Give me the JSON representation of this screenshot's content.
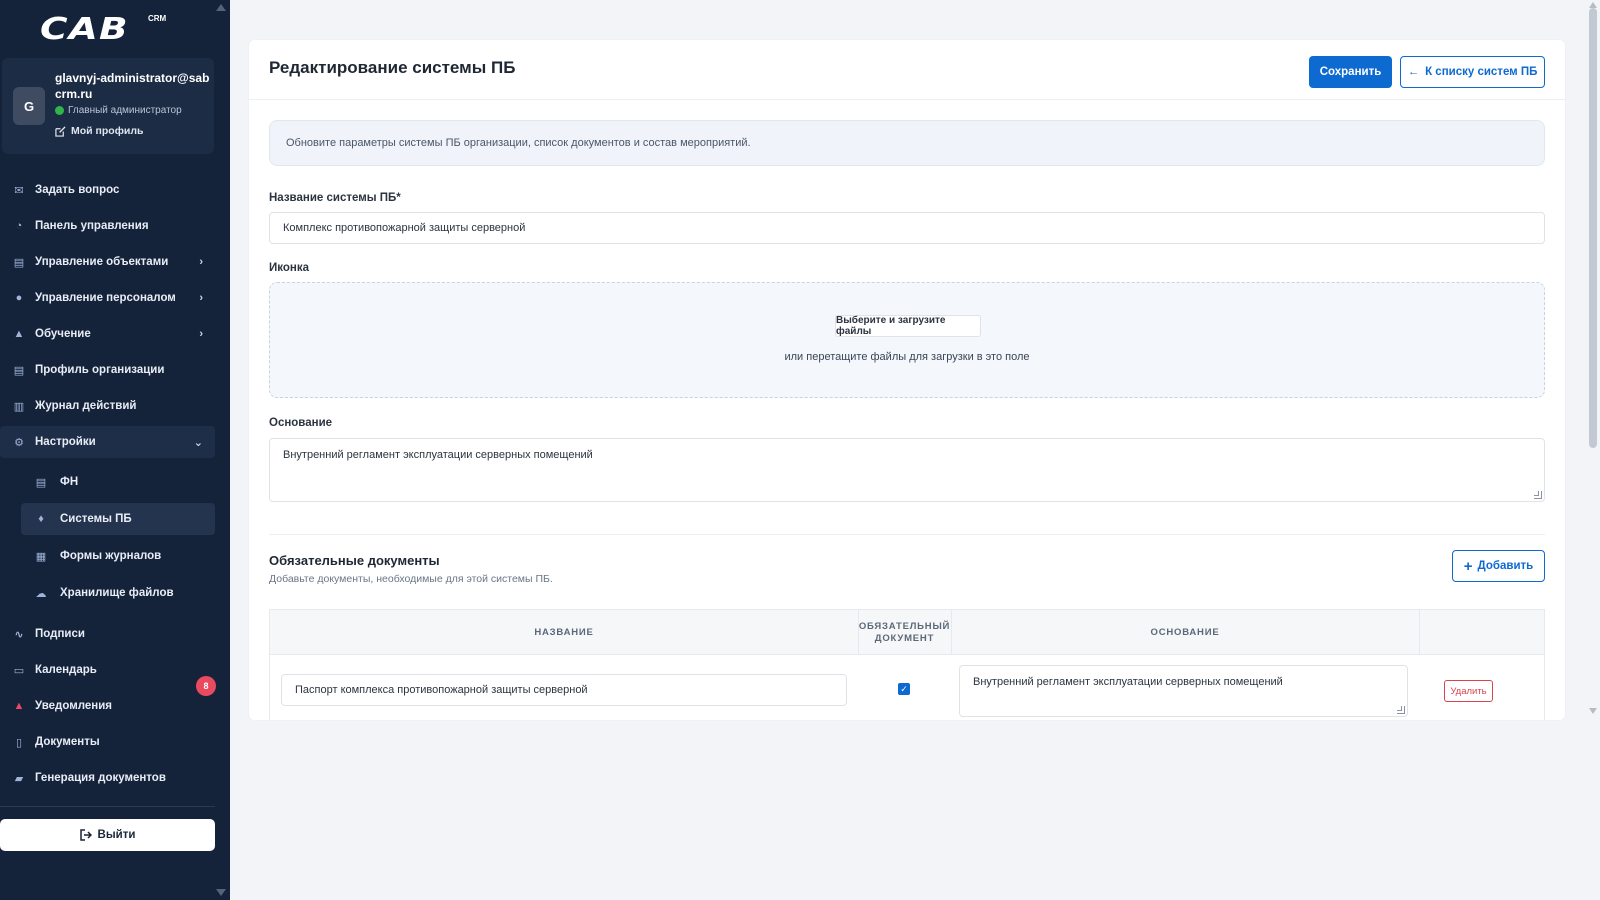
{
  "sidebar": {
    "logo_text": "CAB",
    "logo_badge": "CRM",
    "user": {
      "initial": "G",
      "email": "glavnyj-administrator@sabcrm.ru",
      "role": "Главный администратор",
      "status_color": "#2fb54a",
      "profile_link": "Мой профиль"
    },
    "nav": [
      {
        "label": "Задать вопрос",
        "icon": "envelope-icon"
      },
      {
        "label": "Панель управления",
        "icon": "dashboard-icon"
      },
      {
        "label": "Управление объектами",
        "icon": "building-icon",
        "has_children": true
      },
      {
        "label": "Управление персоналом",
        "icon": "user-icon",
        "has_children": true
      },
      {
        "label": "Обучение",
        "icon": "graduation-cap-icon",
        "has_children": true
      },
      {
        "label": "Профиль организации",
        "icon": "building-icon"
      },
      {
        "label": "Журнал действий",
        "icon": "clipboard-icon"
      },
      {
        "label": "Настройки",
        "icon": "cogs-icon",
        "expanded": true
      },
      {
        "label": "ФН",
        "icon": "building-icon",
        "sub": true
      },
      {
        "label": "Системы ПБ",
        "icon": "fire-icon",
        "sub": true,
        "active": true
      },
      {
        "label": "Формы журналов",
        "icon": "table-icon",
        "sub": true
      },
      {
        "label": "Хранилище файлов",
        "icon": "cloud-icon",
        "sub": true
      },
      {
        "label": "Подписи",
        "icon": "signature-icon"
      },
      {
        "label": "Календарь",
        "icon": "calendar-icon"
      },
      {
        "label": "Уведомления",
        "icon": "bell-icon",
        "badge": "8"
      },
      {
        "label": "Документы",
        "icon": "file-icon"
      },
      {
        "label": "Генерация документов",
        "icon": "folder-open-icon"
      }
    ],
    "logout_label": "Выйти"
  },
  "header": {
    "title": "Редактирование системы ПБ",
    "save_label": "Сохранить",
    "back_label": "К списку систем ПБ"
  },
  "info_text": "Обновите параметры системы ПБ организации, список документов и состав мероприятий.",
  "form": {
    "name_label": "Название системы ПБ*",
    "name_value": "Комплекс противопожарной защиты серверной",
    "icon_label": "Иконка",
    "upload_button": "Выберите и загрузите файлы",
    "upload_hint": "или перетащите файлы для загрузки в это поле",
    "basis_label": "Основание",
    "basis_value": "Внутренний регламент эксплуатации серверных помещений"
  },
  "documents": {
    "title": "Обязательные документы",
    "subtitle": "Добавьте документы, необходимые для этой системы ПБ.",
    "add_label": "Добавить",
    "columns": [
      "НАЗВАНИЕ",
      "ОБЯЗАТЕЛЬНЫЙ ДОКУМЕНТ",
      "ОСНОВАНИЕ",
      ""
    ],
    "rows": [
      {
        "name": "Паспорт комплекса противопожарной защиты серверной",
        "required": true,
        "basis": "Внутренний регламент эксплуатации серверных помещений",
        "delete_label": "Удалить"
      }
    ]
  },
  "colors": {
    "sidebar_bg": "#14223a",
    "primary": "#0d6ad1",
    "danger": "#d9434f",
    "badge": "#e84a5f"
  }
}
